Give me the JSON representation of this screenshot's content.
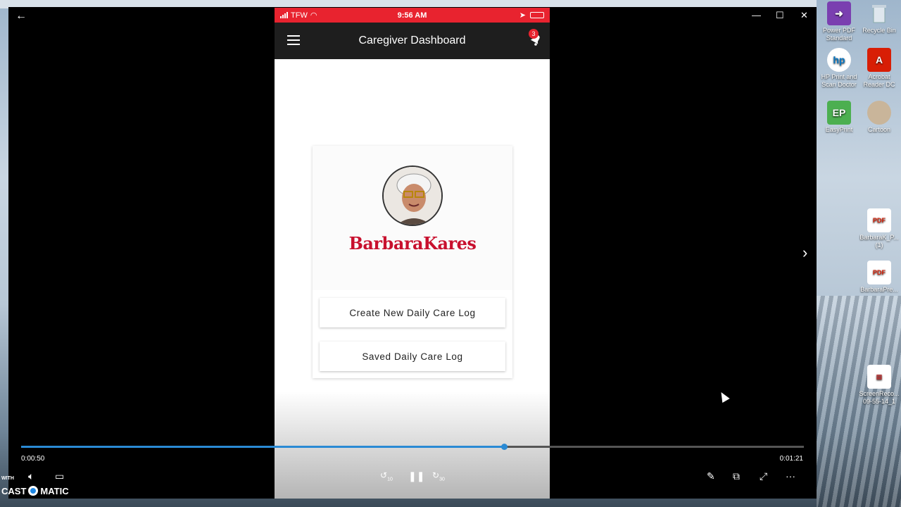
{
  "phone": {
    "status": {
      "carrier": "TFW",
      "time": "9:56 AM"
    },
    "appbar": {
      "title": "Caregiver Dashboard",
      "notification_count": "3"
    },
    "brand": "BarbaraKares",
    "buttons": {
      "create_log": "Create New Daily Care Log",
      "saved_log": "Saved Daily Care Log"
    }
  },
  "player": {
    "current_time": "0:00:50",
    "total_time": "0:01:21",
    "progress": 0.617,
    "rewind_label": "10",
    "forward_label": "30"
  },
  "desktop": {
    "icons": [
      {
        "label": "Power PDF Standard"
      },
      {
        "label": "Recycle Bin"
      },
      {
        "label": "HP Print and Scan Doctor"
      },
      {
        "label": "Acrobat Reader DC"
      },
      {
        "label": "EasyPrint"
      },
      {
        "label": "Cartoon"
      },
      {
        "label": "BarbaraK_P... (1)"
      },
      {
        "label": "BarbaraPre..."
      },
      {
        "label": "ScreenReco... 09-55-14_1"
      }
    ]
  },
  "watermark": {
    "with": "WITH",
    "left": "CAST",
    "right": "MATIC"
  },
  "colors": {
    "status_bar": "#e8232f",
    "app_bar": "#1e1e1e",
    "brand": "#c8102e",
    "progress": "#2a8ad4"
  }
}
